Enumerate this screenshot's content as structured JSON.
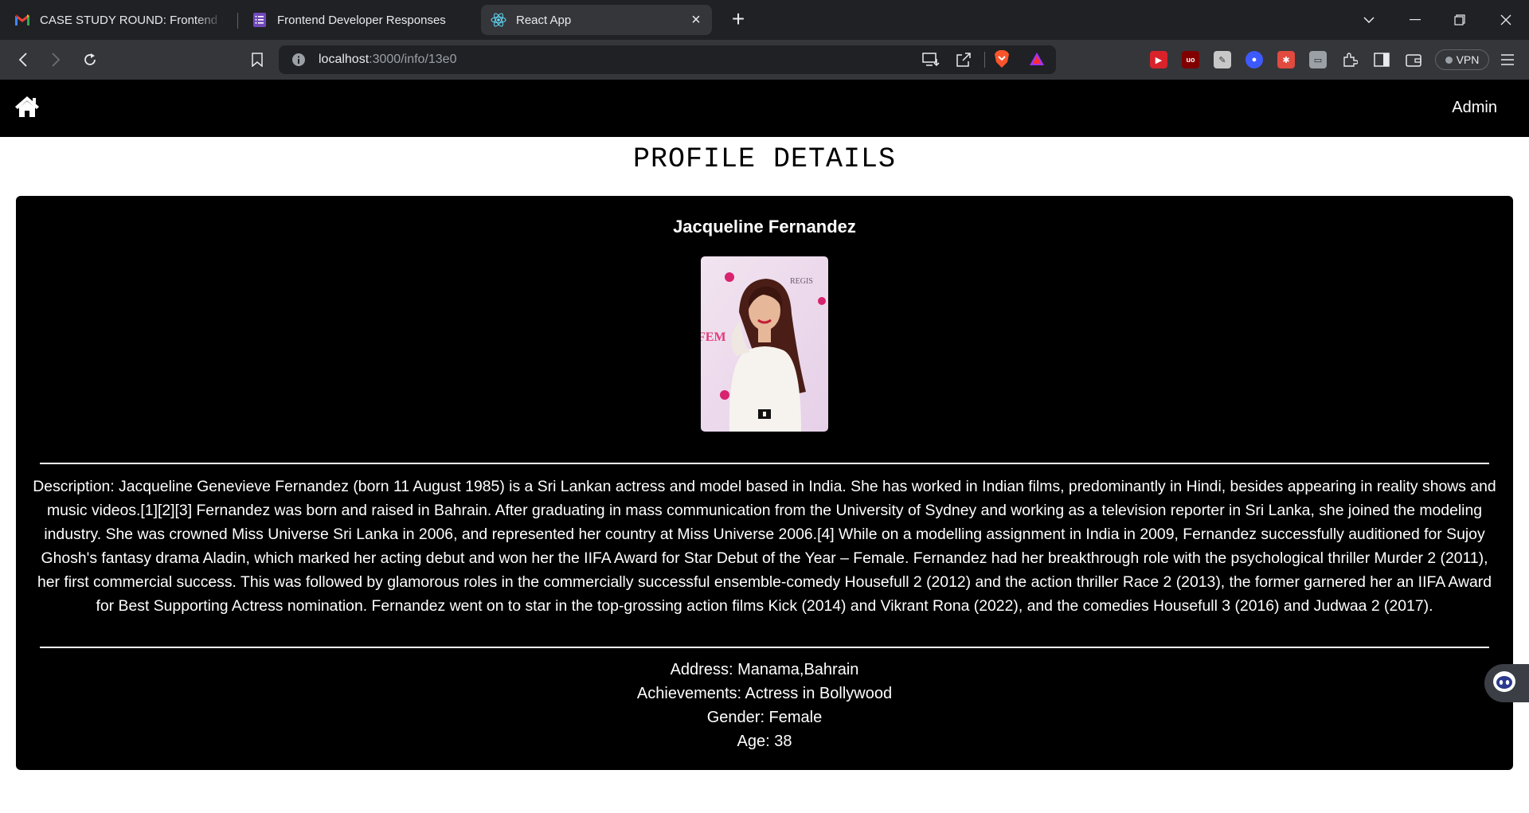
{
  "browser": {
    "tabs": [
      {
        "title": "CASE STUDY ROUND: Frontend Developer",
        "icon": "gmail-icon",
        "active": false
      },
      {
        "title": "Frontend Developer Responses",
        "icon": "forms-icon",
        "active": false
      },
      {
        "title": "React App",
        "icon": "react-icon",
        "active": true
      }
    ],
    "url_host": "localhost",
    "url_path": ":3000/info/13e0",
    "vpn_label": "VPN"
  },
  "app": {
    "nav": {
      "admin_label": "Admin"
    },
    "page_title": "PROFILE DETAILS",
    "profile": {
      "name": "Jacqueline Fernandez",
      "description": "Description: Jacqueline Genevieve Fernandez (born 11 August 1985) is a Sri Lankan actress and model based in India. She has worked in Indian films, predominantly in Hindi, besides appearing in reality shows and music videos.[1][2][3] Fernandez was born and raised in Bahrain. After graduating in mass communication from the University of Sydney and working as a television reporter in Sri Lanka, she joined the modeling industry. She was crowned Miss Universe Sri Lanka in 2006, and represented her country at Miss Universe 2006.[4] While on a modelling assignment in India in 2009, Fernandez successfully auditioned for Sujoy Ghosh's fantasy drama Aladin, which marked her acting debut and won her the IIFA Award for Star Debut of the Year – Female. Fernandez had her breakthrough role with the psychological thriller Murder 2 (2011), her first commercial success. This was followed by glamorous roles in the commercially successful ensemble-comedy Housefull 2 (2012) and the action thriller Race 2 (2013), the former garnered her an IIFA Award for Best Supporting Actress nomination. Fernandez went on to star in the top-grossing action films Kick (2014) and Vikrant Rona (2022), and the comedies Housefull 3 (2016) and Judwaa 2 (2017).",
      "address": "Address: Manama,Bahrain",
      "achievements": "Achievements: Actress in Bollywood",
      "gender": "Gender: Female",
      "age": "Age: 38"
    }
  },
  "colors": {
    "tabbar_bg": "#202124",
    "toolbar_bg": "#35363a",
    "app_nav_bg": "#000000",
    "card_bg": "#000000",
    "text_on_dark": "#ffffff"
  }
}
